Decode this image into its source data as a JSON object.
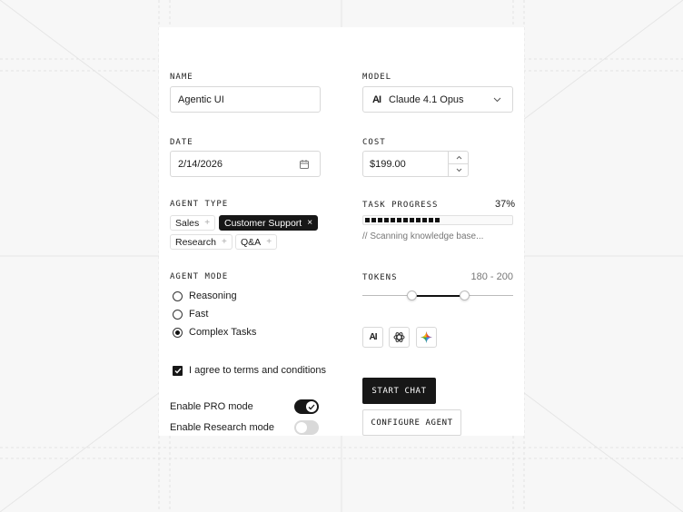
{
  "name_field": {
    "label": "NAME",
    "value": "Agentic UI"
  },
  "model_field": {
    "label": "MODEL",
    "logo": "AI",
    "value": "Claude 4.1 Opus"
  },
  "date_field": {
    "label": "DATE",
    "value": "2/14/2026"
  },
  "cost_field": {
    "label": "COST",
    "value": "$199.00"
  },
  "agent_type": {
    "label": "AGENT TYPE",
    "tags": [
      {
        "label": "Sales",
        "icon": "+",
        "selected": false
      },
      {
        "label": "Customer Support",
        "icon": "×",
        "selected": true
      },
      {
        "label": "Research",
        "icon": "+",
        "selected": false
      },
      {
        "label": "Q&A",
        "icon": "+",
        "selected": false
      }
    ]
  },
  "task_progress": {
    "label": "TASK PROGRESS",
    "percent_text": "37%",
    "percent": 37,
    "status": "// Scanning knowledge base..."
  },
  "agent_mode": {
    "label": "AGENT MODE",
    "options": [
      {
        "label": "Reasoning",
        "selected": false
      },
      {
        "label": "Fast",
        "selected": false
      },
      {
        "label": "Complex Tasks",
        "selected": true
      }
    ]
  },
  "tokens": {
    "label": "TOKENS",
    "range_text": "180 - 200",
    "low_fraction": 0.33,
    "high_fraction": 0.68
  },
  "providers": [
    "anthropic-icon",
    "openai-icon",
    "gemini-icon"
  ],
  "terms": {
    "label": "I agree to terms and conditions",
    "checked": true
  },
  "toggles": [
    {
      "label": "Enable PRO mode",
      "on": true
    },
    {
      "label": "Enable Research mode",
      "on": false
    }
  ],
  "buttons": {
    "start": "START CHAT",
    "configure": "CONFIGURE AGENT"
  },
  "colors": {
    "dark": "#171717",
    "border": "#d8d8d8",
    "muted": "#777777"
  }
}
